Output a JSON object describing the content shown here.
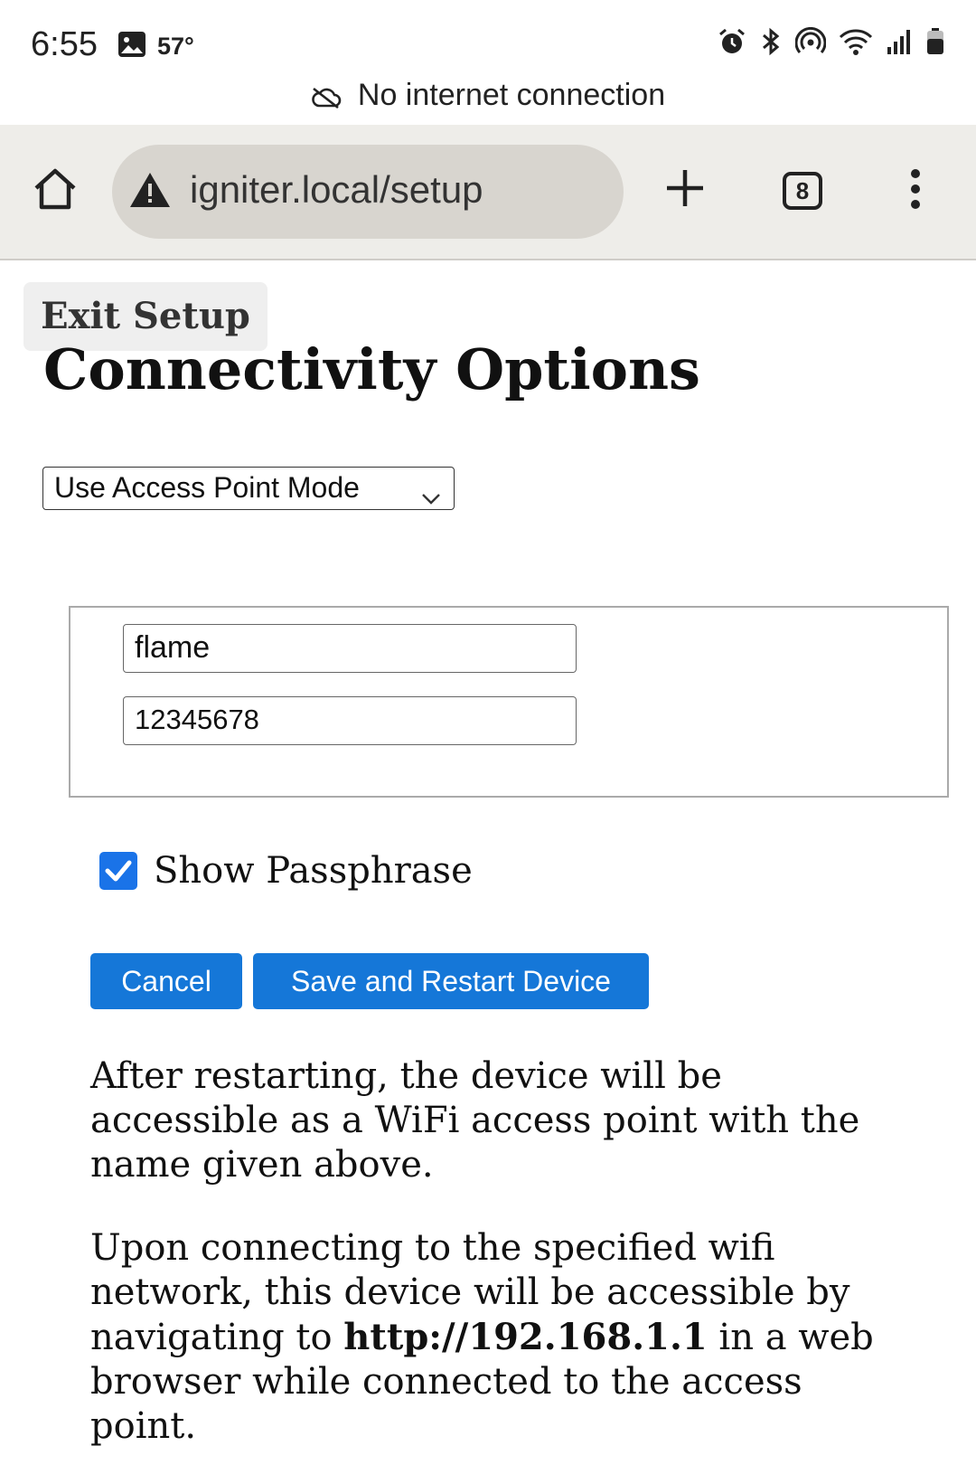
{
  "status_bar": {
    "time": "6:55",
    "temperature": "57°",
    "icons": [
      "gallery-icon",
      "alarm-icon",
      "bluetooth-icon",
      "hotspot-icon",
      "wifi-icon",
      "signal-icon",
      "battery-icon"
    ],
    "banner": "No internet connection"
  },
  "toolbar": {
    "url": "igniter.local/setup",
    "tab_count": "8"
  },
  "page": {
    "exit_label": "Exit Setup",
    "title": "Connectivity Options",
    "mode_selected": "Use Access Point Mode",
    "ssid_value": "flame",
    "passphrase_value": "12345678",
    "show_passphrase_label": "Show Passphrase",
    "show_passphrase_checked": true,
    "cancel_label": "Cancel",
    "save_label": "Save and Restart Device",
    "info1": "After restarting, the device will be accessible as a WiFi access point with the name given above.",
    "info2_pre": "Upon connecting to the specified wifi network, this device will be accessible by navigating to ",
    "info2_ip": "http://192.168.1.1",
    "info2_post": " in a web browser while connected to the access point."
  },
  "colors": {
    "button_blue": "#1577d8",
    "checkbox_blue": "#1a73e8",
    "toolbar_bg": "#eeede9",
    "url_pill_bg": "#d8d5cf"
  }
}
